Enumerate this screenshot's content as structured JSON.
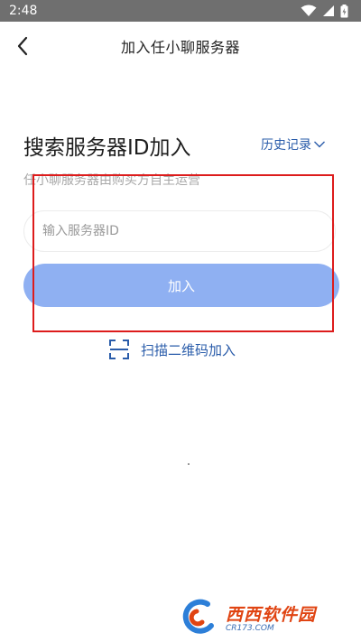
{
  "status_bar": {
    "time": "2:48"
  },
  "header": {
    "title": "加入任小聊服务器"
  },
  "main": {
    "heading": "搜索服务器ID加入",
    "history_link": "历史记录",
    "subtitle": "任小聊服务器由购买方自主运营",
    "input": {
      "placeholder": "输入服务器ID",
      "value": ""
    },
    "join_button": "加入",
    "scan_link": "扫描二维码加入"
  },
  "watermark": {
    "brand": "西西软件园",
    "url": "CR173.COM"
  },
  "colors": {
    "accent": "#2a5caa",
    "button": "#8fb0f2",
    "highlight": "#dd1c1c",
    "status_bar": "#6f6f6f"
  },
  "icons": [
    "back-arrow-icon",
    "wifi-icon",
    "signal-icon",
    "battery-icon",
    "chevron-down-icon",
    "qr-scan-icon"
  ]
}
